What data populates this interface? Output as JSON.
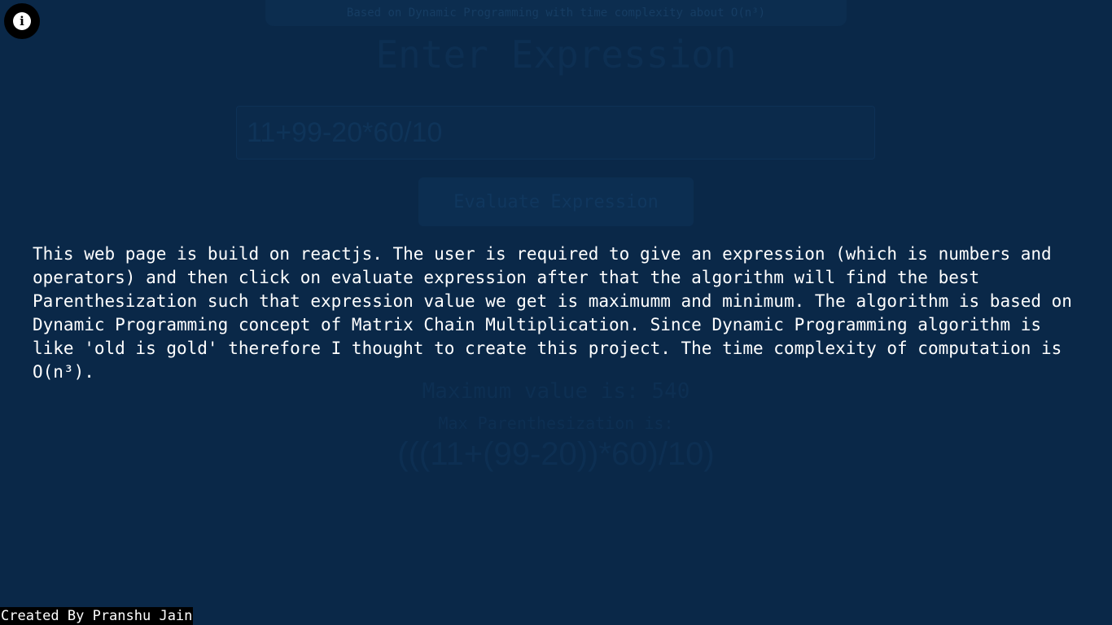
{
  "app": {
    "subtitle": "Based on Dynamic Programming with time complexity about O(n³)",
    "heading": "Enter Expression",
    "hint": "",
    "input_value": "11+99-20*60/10",
    "evaluate_button_label": "Evaluate Expression",
    "max_value_text": "Maximum value is: 540",
    "max_paren_label": "Max Parenthesization is:",
    "max_paren_expr": "(((11+(99-20))*60)/10)"
  },
  "overlay": {
    "info_icon": "info-icon",
    "info_glyph": "i",
    "about_text": "This web page is build on reactjs. The user is required to give an expression (which is numbers and operators) and then click on evaluate expression after that the algorithm will find the best Parenthesization such that expression value we get is maximumm and minimum. The algorithm is based on Dynamic Programming concept of Matrix Chain Multiplication. Since Dynamic Programming algorithm is like 'old is gold' therefore I thought to create this project. The time complexity of computation is O(n³)."
  },
  "footer": {
    "credit": "Created By Pranshu Jain"
  },
  "colors": {
    "background": "#0a2848",
    "overlay_text": "#ffffff",
    "footer_bg": "#000000"
  }
}
